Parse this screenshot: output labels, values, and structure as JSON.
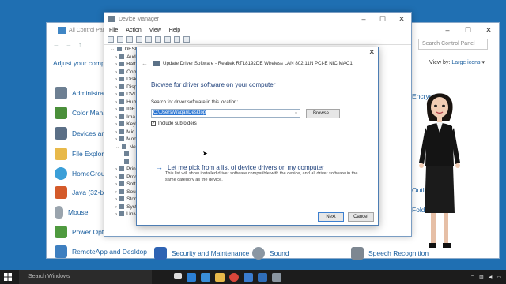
{
  "control_panel": {
    "title": "All Control Panel Items",
    "search_placeholder": "Search Control Panel",
    "adjust_text": "Adjust your compu",
    "view_by_label": "View by:",
    "view_by_value": "Large icons",
    "items": [
      {
        "label": "Administra",
        "icon": "admin-tools-icon",
        "color": "#6d7f92"
      },
      {
        "label": "Color Mana",
        "icon": "color-management-icon",
        "color": "#4a8f3a"
      },
      {
        "label": "Devices an",
        "icon": "devices-icon",
        "color": "#5b6f86"
      },
      {
        "label": "File Explorer",
        "icon": "folder-icon",
        "color": "#e8b94a"
      },
      {
        "label": "HomeGroup",
        "icon": "homegroup-icon",
        "color": "#3b9fd8"
      },
      {
        "label": "Java (32-bit)",
        "icon": "java-icon",
        "color": "#d45a2a"
      },
      {
        "label": "Mouse",
        "icon": "mouse-icon",
        "color": "#9aa4ad"
      },
      {
        "label": "Power Optio",
        "icon": "power-icon",
        "color": "#4f9a3f"
      },
      {
        "label": "RemoteApp and Desktop",
        "icon": "remoteapp-icon",
        "color": "#3e7fc0"
      },
      {
        "label": "Security and Maintenance",
        "icon": "flag-icon",
        "color": "#2e63b3"
      },
      {
        "label": "Sound",
        "icon": "sound-icon",
        "color": "#8a96a2"
      },
      {
        "label": "Speech Recognition",
        "icon": "microphone-icon",
        "color": "#7d8791"
      }
    ],
    "right_items": [
      {
        "label": "Encrypti"
      },
      {
        "label": "Outloo"
      },
      {
        "label": "Folders"
      }
    ]
  },
  "device_manager": {
    "title": "Device Manager",
    "menu": [
      "File",
      "Action",
      "View",
      "Help"
    ],
    "tree": [
      {
        "label": "DESKTO",
        "arrow": "⌄"
      },
      {
        "label": "Aud",
        "arrow": "›"
      },
      {
        "label": "Batt",
        "arrow": "›"
      },
      {
        "label": "Com",
        "arrow": "›"
      },
      {
        "label": "Disk",
        "arrow": "›"
      },
      {
        "label": "Disp",
        "arrow": "›"
      },
      {
        "label": "DVD",
        "arrow": "›"
      },
      {
        "label": "Hum",
        "arrow": "›"
      },
      {
        "label": "IDE",
        "arrow": "›"
      },
      {
        "label": "Ima",
        "arrow": "›"
      },
      {
        "label": "Keyl",
        "arrow": "›"
      },
      {
        "label": "Mic",
        "arrow": "›"
      },
      {
        "label": "Mon",
        "arrow": "›"
      },
      {
        "label": "Net",
        "arrow": "⌄"
      },
      {
        "label": "",
        "arrow": ""
      },
      {
        "label": "",
        "arrow": ""
      },
      {
        "label": "Prin",
        "arrow": "›"
      },
      {
        "label": "Proc",
        "arrow": "›"
      },
      {
        "label": "Soft",
        "arrow": "›"
      },
      {
        "label": "Sou",
        "arrow": "›"
      },
      {
        "label": "Stor",
        "arrow": "›"
      },
      {
        "label": "Syst",
        "arrow": "›"
      },
      {
        "label": "Univ",
        "arrow": "›"
      }
    ]
  },
  "dialog": {
    "header": "Update Driver Software - Realtek RTL8192DE Wireless LAN 802.11N PCI-E NIC MAC1",
    "heading": "Browse for driver software on your computer",
    "search_label": "Search for driver software in this location:",
    "path_value": "C:\\Users\\Waqar\\Desktop",
    "browse_label": "Browse...",
    "include_subfolders_label": "Include subfolders",
    "include_subfolders_checked": true,
    "link_text": "Let me pick from a list of device drivers on my computer",
    "link_desc": "This list will show installed driver software compatible with the device, and all driver software in the same category as the device.",
    "next_label": "Next",
    "cancel_label": "Cancel",
    "close_glyph": "✕",
    "back_glyph": "←"
  },
  "taskbar": {
    "search_text": "Search Windows",
    "apps": [
      {
        "icon": "task-view-icon",
        "color": "#dddddd"
      },
      {
        "icon": "edge-icon",
        "color": "#2b7fd4"
      },
      {
        "icon": "store-icon",
        "color": "#3a8fd8"
      },
      {
        "icon": "file-explorer-icon",
        "color": "#e8b94a"
      },
      {
        "icon": "chrome-icon",
        "color": "#d8463a"
      },
      {
        "icon": "mail-icon",
        "color": "#3a7ccf"
      },
      {
        "icon": "photos-icon",
        "color": "#2f6db8"
      },
      {
        "icon": "device-manager-icon",
        "color": "#8a95a0"
      }
    ]
  }
}
